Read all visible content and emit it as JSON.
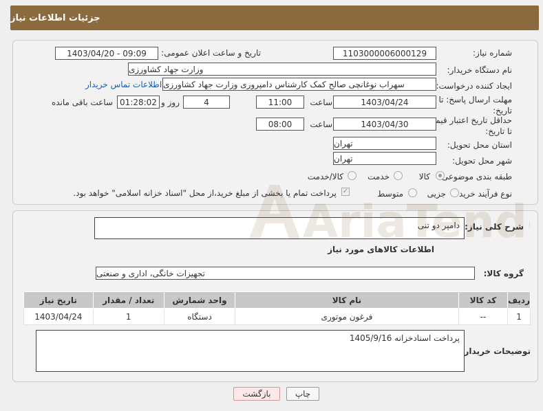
{
  "header": {
    "title": "جزئیات اطلاعات نیاز"
  },
  "form": {
    "need_number_label": "شماره نیاز:",
    "need_number": "1103000006000129",
    "announce_label": "تاریخ و ساعت اعلان عمومی:",
    "announce_value": "1403/04/20 - 09:09",
    "buyer_label": "نام دستگاه خریدار:",
    "buyer_value": "وزارت جهاد کشاورزی",
    "creator_label": "ایجاد کننده درخواست:",
    "creator_value": "سهراب نوغانچی صالح کمک کارشناس دامپروری وزارت جهاد کشاورزی",
    "contact_link": "اطلاعات تماس خریدار",
    "deadline_label": "مهلت ارسال پاسخ: تا تاریخ:",
    "deadline_date": "1403/04/24",
    "time_label": "ساعت",
    "deadline_time": "11:00",
    "days_value": "4",
    "days_label": "روز و",
    "remaining_time": "01:28:02",
    "remaining_label": "ساعت باقی مانده",
    "validity_label": "حداقل تاریخ اعتبار قیمت: تا تاریخ:",
    "validity_date": "1403/04/30",
    "validity_time": "08:00",
    "province_label": "استان محل تحویل:",
    "province_value": "تهران",
    "city_label": "شهر محل تحویل:",
    "city_value": "تهران",
    "category_label": "طبقه بندی موضوعی:",
    "cat_goods": "کالا",
    "cat_service": "خدمت",
    "cat_both": "کالا/خدمت",
    "process_label": "نوع فرآیند خرید :",
    "proc_partial": "جزیی",
    "proc_medium": "متوسط",
    "payment_note": "پرداخت تمام یا بخشی از مبلغ خرید،از محل \"اسناد خزانه اسلامی\" خواهد بود."
  },
  "details": {
    "desc_label": "شرح کلی نیاز:",
    "desc_value": "دامپر دو تنی",
    "goods_info_title": "اطلاعات کالاهای مورد نیاز",
    "group_label": "گروه کالا:",
    "group_value": "تجهیزات خانگی، اداری و صنعتی",
    "table": {
      "headers": [
        "ردیف",
        "کد کالا",
        "نام کالا",
        "واحد شمارش",
        "تعداد / مقدار",
        "تاریخ نیاز"
      ],
      "rows": [
        [
          "1",
          "--",
          "فرغون موتوری",
          "دستگاه",
          "1",
          "1403/04/24"
        ]
      ]
    },
    "buyer_notes_label": "توضیحات خریدار:",
    "buyer_notes_value": "پرداخت اسنادخزانه 1405/9/16"
  },
  "buttons": {
    "print": "چاپ",
    "back": "بازگشت"
  },
  "watermark": {
    "text": "AriaTender.neT"
  }
}
